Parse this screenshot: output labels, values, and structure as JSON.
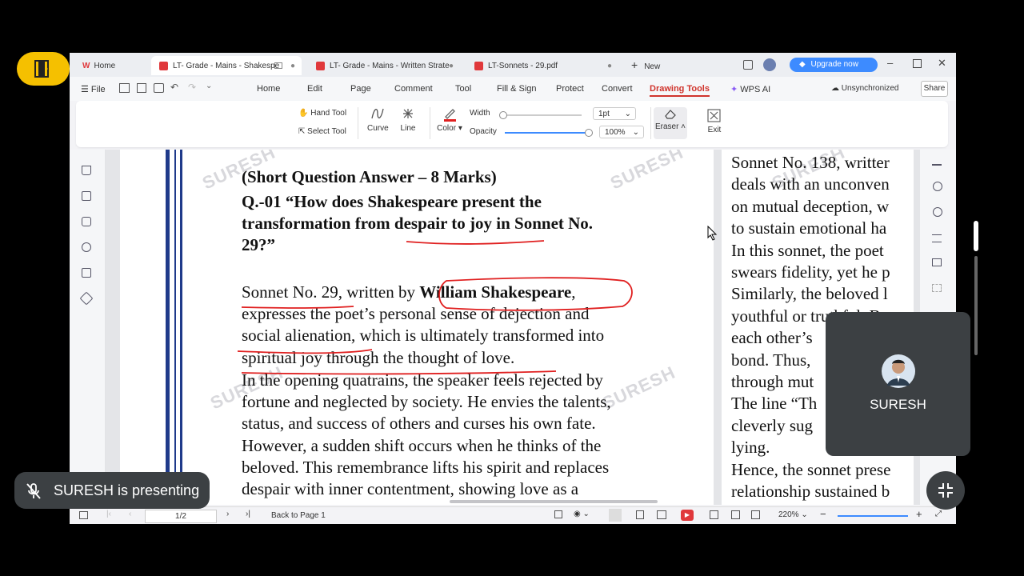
{
  "tabs": [
    {
      "label": "Home",
      "active": false
    },
    {
      "label": "LT- Grade - Mains - Shakespe",
      "active": true
    },
    {
      "label": "LT- Grade - Mains - Written Strate",
      "active": false
    },
    {
      "label": "LT-Sonnets - 29.pdf",
      "active": false
    }
  ],
  "new_tab_label": "New",
  "upgrade_label": "Upgrade now",
  "menu": {
    "file": "File",
    "items": [
      "Home",
      "Edit",
      "Page",
      "Comment",
      "Tool",
      "Fill & Sign",
      "Protect",
      "Convert",
      "Drawing Tools"
    ],
    "active": "Drawing Tools",
    "wps_ai": "WPS AI",
    "sync_status": "Unsynchronized",
    "share": "Share"
  },
  "ribbon": {
    "hand_tool": "Hand Tool",
    "select_tool": "Select Tool",
    "curve": "Curve",
    "line": "Line",
    "color": "Color",
    "width_label": "Width",
    "width_value": "1pt",
    "opacity_label": "Opacity",
    "opacity_value": "100%",
    "eraser": "Eraser",
    "exit": "Exit",
    "pen_color": "#e02020"
  },
  "document": {
    "watermark": "SURESH",
    "left_lines": [
      {
        "text": "(Short Question Answer – 8 Marks)",
        "bold": true
      },
      {
        "text": "Q.-01 “How does Shakespeare present the",
        "bold": true
      },
      {
        "text": "transformation from despair to joy in Sonnet No.",
        "bold": true
      },
      {
        "text": "29?”",
        "bold": true
      },
      {
        "text": "",
        "bold": false
      },
      {
        "text": "Sonnet No. 29, written by ",
        "bold": false,
        "bold_tail": "William Shakespeare",
        "tail": ","
      },
      {
        "text": "expresses the poet’s personal sense of dejection and",
        "bold": false
      },
      {
        "text": "social alienation, which is ultimately transformed into",
        "bold": false
      },
      {
        "text": "spiritual joy through the thought of love.",
        "bold": false
      },
      {
        "text": "In the opening quatrains, the speaker feels rejected by",
        "bold": false
      },
      {
        "text": "fortune and neglected by society. He envies the talents,",
        "bold": false
      },
      {
        "text": "status, and success of others and curses his own fate.",
        "bold": false
      },
      {
        "text": "However, a sudden shift occurs when he thinks of the",
        "bold": false
      },
      {
        "text": "beloved. This remembrance lifts his spirit and replaces",
        "bold": false
      },
      {
        "text": "despair with inner contentment, showing love as a",
        "bold": false
      }
    ],
    "right_lines": [
      "Sonnet No. 138, writter",
      "deals with an unconven",
      "on mutual deception, w",
      "to sustain emotional ha",
      "In this sonnet, the poet",
      "swears fidelity, yet he p",
      "Similarly, the beloved l",
      "youthful or truthful. B",
      "each other’s",
      "bond. Thus,",
      "through mut",
      "The line “Th",
      "cleverly sug",
      "lying.",
      "Hence, the sonnet prese",
      "relationship sustained b"
    ]
  },
  "status": {
    "page": "1/2",
    "back_to_page": "Back to Page 1",
    "zoom": "220%"
  },
  "overlay": {
    "presenter_name": "SURESH",
    "presenting_text": "SURESH is presenting"
  }
}
